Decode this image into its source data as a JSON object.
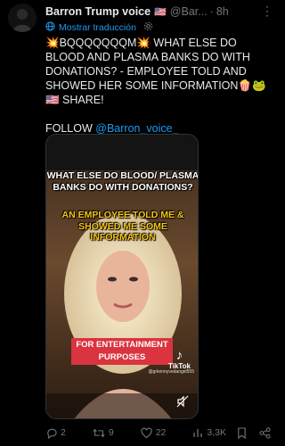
{
  "post": {
    "author_name": "Barron Trump voice",
    "author_flag": "🇺🇸",
    "handle": "@Bar...",
    "separator": "·",
    "time": "8h",
    "more_label": "⋮",
    "translate_label": "Mostrar traducción",
    "text_main": "💥BQQQQQQQM💥 WHAT ELSE DO BLOOD AND PLASMA BANKS DO WITH DONATIONS? - EMPLOYEE TOLD AND SHOWED HER SOME INFORMATION🍿🐸🇺🇸 SHARE!",
    "text_follow_prefix": "FOLLOW ",
    "text_follow_mention": "@Barron_voice_"
  },
  "video": {
    "overlay_white": "WHAT ELSE DO BLOOD/ PLASMA BANKS DO WITH DONATIONS?",
    "overlay_yellow": "AN EMPLOYEE TOLD ME & SHOWED ME SOME INFORMATION",
    "caption": "FOR ENTERTAINMENT PURPOSES",
    "tiktok_label": "TikTok",
    "tiktok_user": "@grkennyvedangel555",
    "icons": {
      "watermark": "tiktok-icon",
      "mute": "mute-icon"
    }
  },
  "actions": {
    "replies": "2",
    "reposts": "9",
    "likes": "22",
    "views": "3,3K",
    "icons": [
      "reply-icon",
      "repost-icon",
      "like-icon",
      "views-icon",
      "bookmark-icon",
      "share-icon"
    ]
  }
}
